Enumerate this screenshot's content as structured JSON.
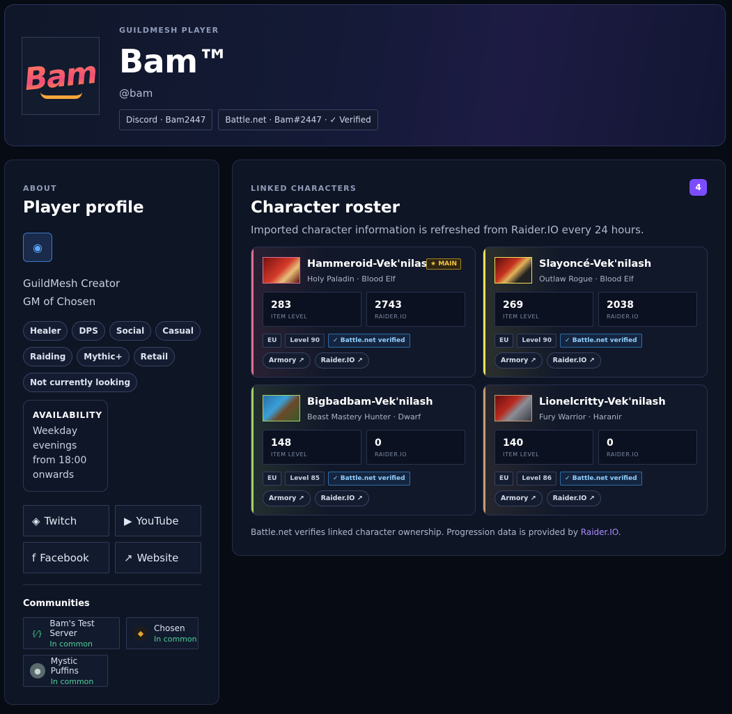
{
  "header": {
    "kicker": "GUILDMESH PLAYER",
    "logo_text": "Bam",
    "name": "Bam™",
    "handle": "@bam",
    "chips": [
      "Discord · Bam2447",
      "Battle.net · Bam#2447 · ✓ Verified"
    ]
  },
  "about": {
    "kicker": "ABOUT",
    "title": "Player profile",
    "badge_icon": "◉",
    "bio": [
      "GuildMesh Creator",
      "GM of Chosen"
    ],
    "tags": [
      "Healer",
      "DPS",
      "Social",
      "Casual",
      "Raiding",
      "Mythic+",
      "Retail",
      "Not currently looking"
    ],
    "availability": {
      "title": "AVAILABILITY",
      "value": "Weekday evenings from 18:00 onwards"
    },
    "links": [
      {
        "icon": "◈",
        "label": "Twitch"
      },
      {
        "icon": "▶",
        "label": "YouTube"
      },
      {
        "icon": "f",
        "label": "Facebook"
      },
      {
        "icon": "↗",
        "label": "Website"
      }
    ],
    "communities_title": "Communities",
    "communities": [
      {
        "name": "Bam's Test Server",
        "status": "In common",
        "icon": "{⁄}"
      },
      {
        "name": "Chosen",
        "status": "In common",
        "icon": "◆"
      },
      {
        "name": "Mystic Puffins",
        "status": "In common",
        "icon": "●"
      }
    ]
  },
  "roster": {
    "kicker": "LINKED CHARACTERS",
    "count": "4",
    "title": "Character roster",
    "subtitle": "Imported character information is refreshed from Raider.IO every 24 hours.",
    "main_badge": "★ MAIN",
    "item_level_label": "ITEM LEVEL",
    "raiderio_label": "RAIDER.IO",
    "armory_label": "Armory ↗",
    "raiderio_btn": "Raider.IO ↗",
    "characters": [
      {
        "name": "Hammeroid-Vek'nilash",
        "spec": "Holy Paladin · Blood Elf",
        "ilvl": "283",
        "rio": "2743",
        "region": "EU",
        "level": "Level 90",
        "verified": "✓ Battle.net verified",
        "accent": "#e0708f",
        "main": true
      },
      {
        "name": "Slayoncé-Vek'nilash",
        "spec": "Outlaw Rogue · Blood Elf",
        "ilvl": "269",
        "rio": "2038",
        "region": "EU",
        "level": "Level 90",
        "verified": "✓ Battle.net verified",
        "accent": "#f1e05a",
        "main": false
      },
      {
        "name": "Bigbadbam-Vek'nilash",
        "spec": "Beast Mastery Hunter · Dwarf",
        "ilvl": "148",
        "rio": "0",
        "region": "EU",
        "level": "Level 85",
        "verified": "✓ Battle.net verified",
        "accent": "#a3d36a",
        "main": false
      },
      {
        "name": "Lionelcritty-Vek'nilash",
        "spec": "Fury Warrior · Haranir",
        "ilvl": "140",
        "rio": "0",
        "region": "EU",
        "level": "Level 86",
        "verified": "✓ Battle.net verified",
        "accent": "#c79c6e",
        "main": false
      }
    ],
    "footer_text": "Battle.net verifies linked character ownership. Progression data is provided by ",
    "footer_link": "Raider.IO",
    "footer_end": "."
  }
}
